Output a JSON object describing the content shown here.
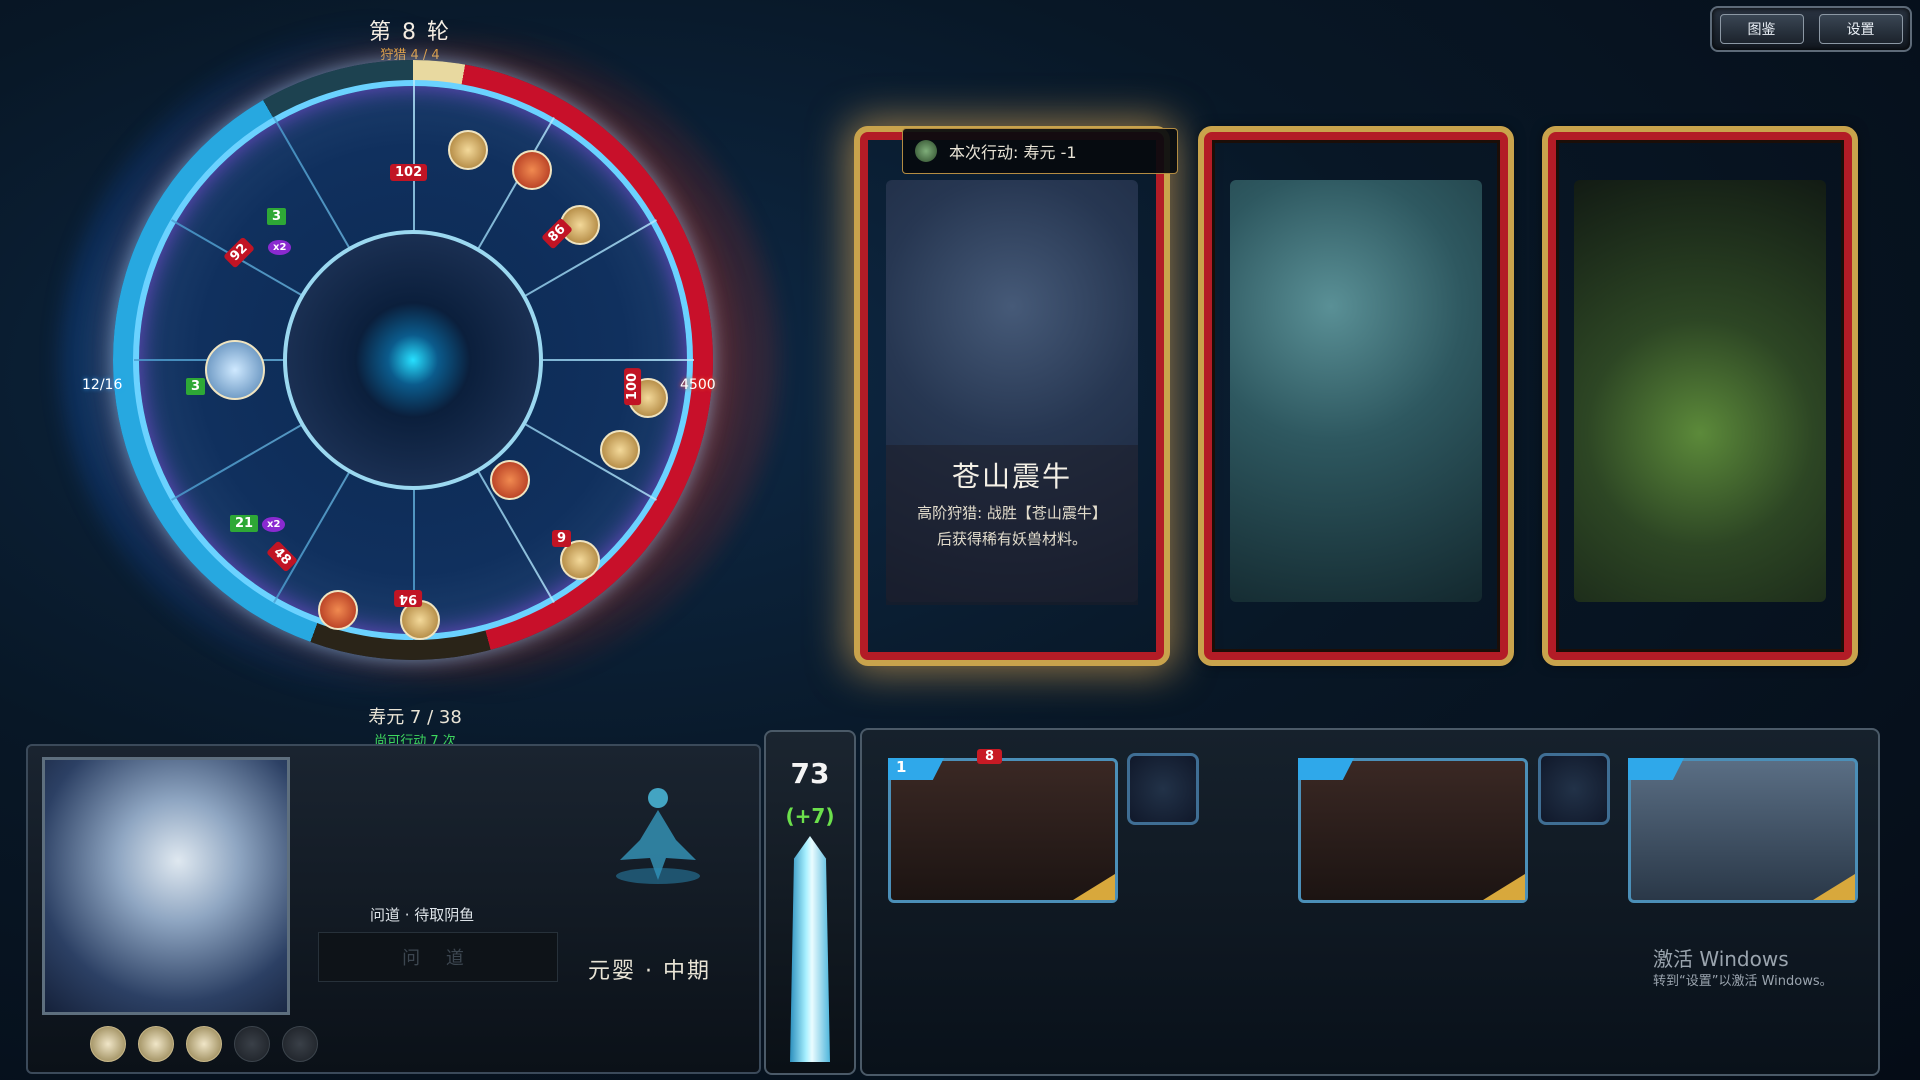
{
  "top_menu": {
    "catalog_label": "图鉴",
    "settings_label": "设置"
  },
  "wheel": {
    "round_label": "第 8 轮",
    "hunt_label": "狩猎 4 / 4",
    "left_counter": "12/16",
    "right_value": "4500",
    "segment_labels": [
      "102",
      "86",
      "92",
      "3",
      "x2",
      "3",
      "100",
      "21",
      "x2",
      "48",
      "9",
      "94"
    ],
    "lifespan_label": "寿元 7 / 38",
    "actions_label": "尚可行动 7 次"
  },
  "tooltip": {
    "text": "本次行动: 寿元 -1"
  },
  "cards": [
    {
      "name": "苍山震牛",
      "description": "高阶狩猎: 战胜【苍山震牛】后获得稀有妖兽材料。"
    },
    {
      "name": "",
      "description": ""
    },
    {
      "name": "",
      "description": ""
    }
  ],
  "character": {
    "task_title": "问道 · 待取阴鱼",
    "task_input": "问 道",
    "realm": "元婴 · 中期"
  },
  "energy": {
    "value": "73",
    "increment": "(+7)"
  },
  "inventory": {
    "item1_level": "1",
    "item1_badge": "8",
    "item3_level": ""
  },
  "watermark": {
    "line1": "激活 Windows",
    "line2": "转到“设置”以激活 Windows。"
  },
  "colors": {
    "accent_gold": "#c9a34c",
    "card_red": "#b31c26",
    "ice_blue": "#27a8e0"
  }
}
